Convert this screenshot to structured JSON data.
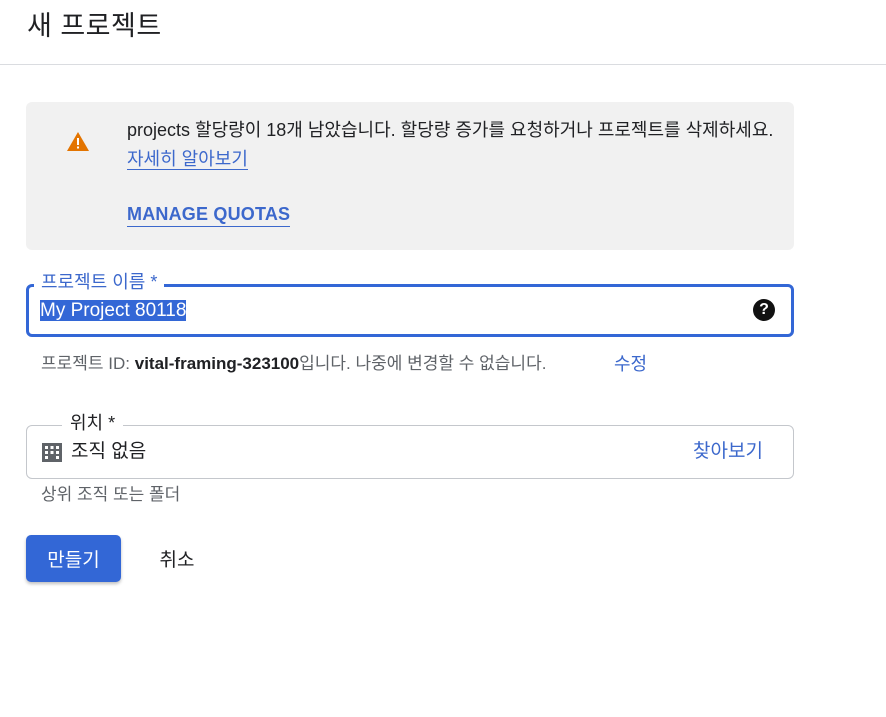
{
  "header": {
    "title": "새 프로젝트"
  },
  "quota_banner": {
    "icon": "warning-icon",
    "icon_color": "#e37400",
    "message": "projects 할당량이 18개 남았습니다. 할당량 증가를 요청하거나 프로젝트를 삭제하세요.",
    "learn_more": "자세히 알아보기",
    "manage_quotas": "MANAGE QUOTAS"
  },
  "project_name": {
    "label": "프로젝트 이름 *",
    "value": "My Project 80118",
    "help_icon": "help-icon"
  },
  "project_id": {
    "prefix": "프로젝트 ID: ",
    "id": "vital-framing-323100",
    "suffix": "입니다. 나중에 변경할 수 없습니다.",
    "edit": "수정"
  },
  "location": {
    "label": "위치 *",
    "icon": "building-icon",
    "value": "조직 없음",
    "browse": "찾아보기",
    "helper": "상위 조직 또는 폴더"
  },
  "actions": {
    "create": "만들기",
    "cancel": "취소"
  },
  "colors": {
    "accent": "#3367d6",
    "link": "#3c68cc",
    "warning": "#e37400"
  }
}
